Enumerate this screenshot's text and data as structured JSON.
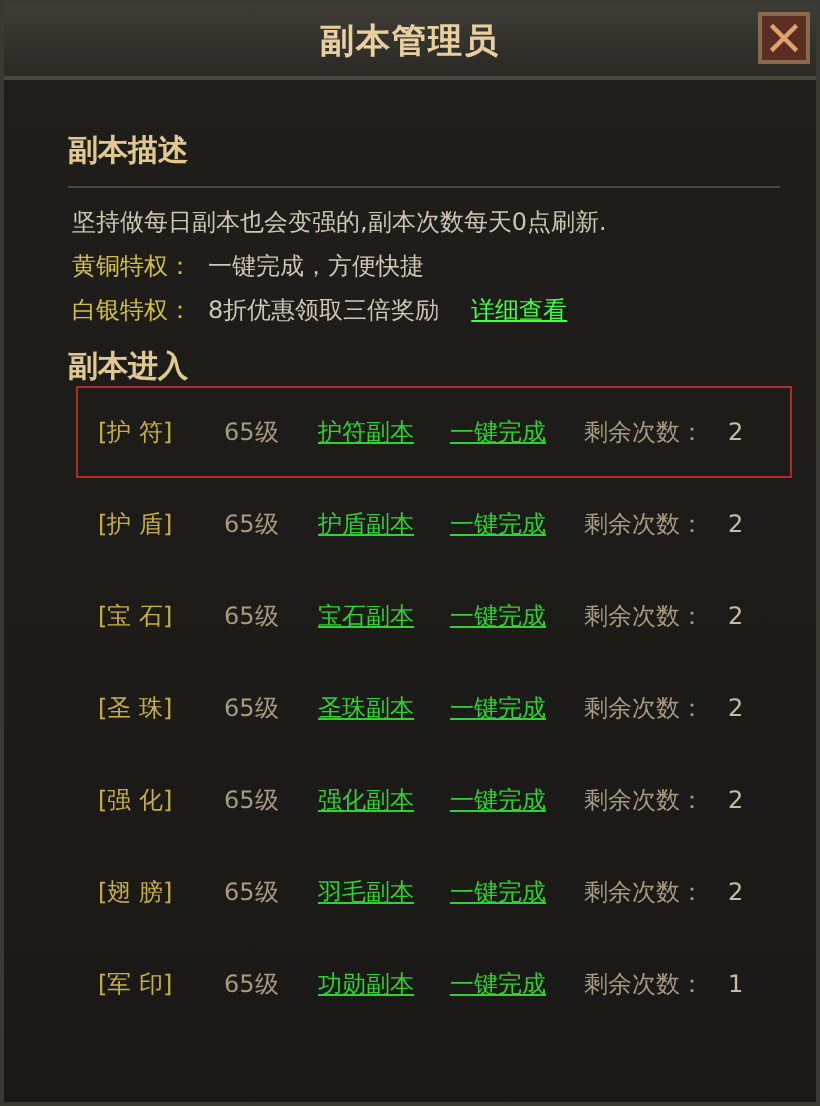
{
  "window": {
    "title": "副本管理员"
  },
  "description": {
    "heading": "副本描述",
    "text": "坚持做每日副本也会变强的,副本次数每天0点刷新.",
    "privileges": [
      {
        "label": "黄铜特权：",
        "text": "一键完成，方便快捷"
      },
      {
        "label": "白银特权：",
        "text": "8折优惠领取三倍奖励",
        "link": "详细查看"
      }
    ]
  },
  "entry": {
    "heading": "副本进入",
    "rows": [
      {
        "name": "[护 符]",
        "level": "65级",
        "dungeon": "护符副本",
        "quick": "一键完成",
        "remaining_label": "剩余次数：",
        "remaining": "2",
        "selected": true
      },
      {
        "name": "[护 盾]",
        "level": "65级",
        "dungeon": "护盾副本",
        "quick": "一键完成",
        "remaining_label": "剩余次数：",
        "remaining": "2",
        "selected": false
      },
      {
        "name": "[宝 石]",
        "level": "65级",
        "dungeon": "宝石副本",
        "quick": "一键完成",
        "remaining_label": "剩余次数：",
        "remaining": "2",
        "selected": false
      },
      {
        "name": "[圣 珠]",
        "level": "65级",
        "dungeon": "圣珠副本",
        "quick": "一键完成",
        "remaining_label": "剩余次数：",
        "remaining": "2",
        "selected": false
      },
      {
        "name": "[强 化]",
        "level": "65级",
        "dungeon": "强化副本",
        "quick": "一键完成",
        "remaining_label": "剩余次数：",
        "remaining": "2",
        "selected": false
      },
      {
        "name": "[翅 膀]",
        "level": "65级",
        "dungeon": "羽毛副本",
        "quick": "一键完成",
        "remaining_label": "剩余次数：",
        "remaining": "2",
        "selected": false
      },
      {
        "name": "[军 印]",
        "level": "65级",
        "dungeon": "功勋副本",
        "quick": "一键完成",
        "remaining_label": "剩余次数：",
        "remaining": "1",
        "selected": false
      }
    ]
  }
}
